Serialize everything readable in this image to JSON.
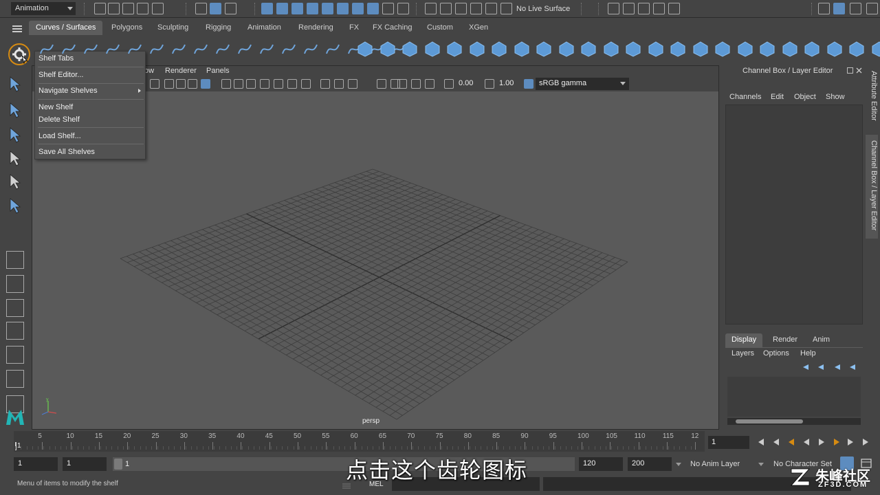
{
  "status_line": {
    "menu_set": "Animation",
    "live_surface": "No Live Surface"
  },
  "shelf_tabs": [
    {
      "label": "Curves / Surfaces",
      "active": true
    },
    {
      "label": "Polygons"
    },
    {
      "label": "Sculpting"
    },
    {
      "label": "Rigging"
    },
    {
      "label": "Animation"
    },
    {
      "label": "Rendering"
    },
    {
      "label": "FX"
    },
    {
      "label": "FX Caching"
    },
    {
      "label": "Custom"
    },
    {
      "label": "XGen"
    }
  ],
  "shelf_menu": {
    "items": [
      {
        "label": "Shelf Tabs"
      },
      {
        "label": "Shelf Editor..."
      },
      {
        "label": "Navigate Shelves",
        "submenu": true
      },
      {
        "label": "New Shelf"
      },
      {
        "label": "Delete Shelf"
      },
      {
        "label": "Load Shelf..."
      },
      {
        "label": "Save All Shelves"
      }
    ]
  },
  "viewport": {
    "menus": [
      "ow",
      "Renderer",
      "Panels"
    ],
    "exposure": "0.00",
    "gamma": "1.00",
    "color_space": "sRGB gamma",
    "camera_label": "persp"
  },
  "channel_box": {
    "title": "Channel Box / Layer Editor",
    "menus": [
      "Channels",
      "Edit",
      "Object",
      "Show"
    ],
    "layer_tabs": [
      {
        "label": "Display",
        "active": true
      },
      {
        "label": "Render"
      },
      {
        "label": "Anim"
      }
    ],
    "layer_menus": [
      "Layers",
      "Options",
      "Help"
    ]
  },
  "side_tabs": [
    "Attribute Editor",
    "Channel Box / Layer Editor"
  ],
  "timeline": {
    "ticks": [
      "5",
      "10",
      "15",
      "20",
      "25",
      "30",
      "35",
      "40",
      "45",
      "50",
      "55",
      "60",
      "65",
      "70",
      "75",
      "80",
      "85",
      "90",
      "95",
      "100",
      "105",
      "110",
      "115",
      "12"
    ],
    "start_label": "1",
    "current_frame": "1"
  },
  "range": {
    "start": "1",
    "playback_start": "1",
    "thumb_label": "1",
    "playback_end": "120",
    "end": "200",
    "anim_layer": "No Anim Layer",
    "character_set": "No Character Set"
  },
  "help_line": "Menu of items to modify the shelf",
  "command": {
    "language": "MEL"
  },
  "subtitle": "点击这个齿轮图标",
  "watermark": {
    "brand": "朱峰社区",
    "url": "ZF3D.COM"
  },
  "colors": {
    "accent_blue": "#5d8cbf",
    "highlight_orange": "#d68b12",
    "panel": "#444444",
    "viewport_bg": "#5a5a5a"
  }
}
